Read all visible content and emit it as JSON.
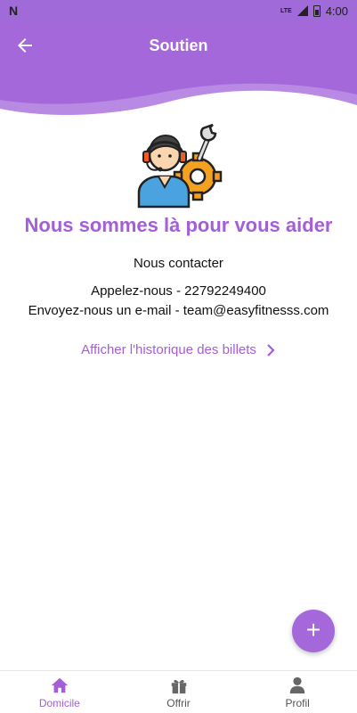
{
  "status_bar": {
    "time": "4:00",
    "network": "LTE"
  },
  "app_bar": {
    "title": "Soutien"
  },
  "main": {
    "headline": "Nous sommes là pour vous aider",
    "contact_title": "Nous contacter",
    "phone_line": "Appelez-nous - 22792249400",
    "email_line": "Envoyez-nous un e-mail - team@easyfitnesss.com",
    "history_link": "Afficher l'historique des billets"
  },
  "fab": {
    "label": "+"
  },
  "bottom_nav": {
    "items": [
      {
        "label": "Domicile",
        "icon": "home-icon",
        "active": true
      },
      {
        "label": "Offrir",
        "icon": "gift-icon",
        "active": false
      },
      {
        "label": "Profil",
        "icon": "person-icon",
        "active": false
      }
    ]
  },
  "colors": {
    "accent": "#a468da",
    "accent_text": "#a35ed8",
    "wave_light": "#b88ae3"
  }
}
